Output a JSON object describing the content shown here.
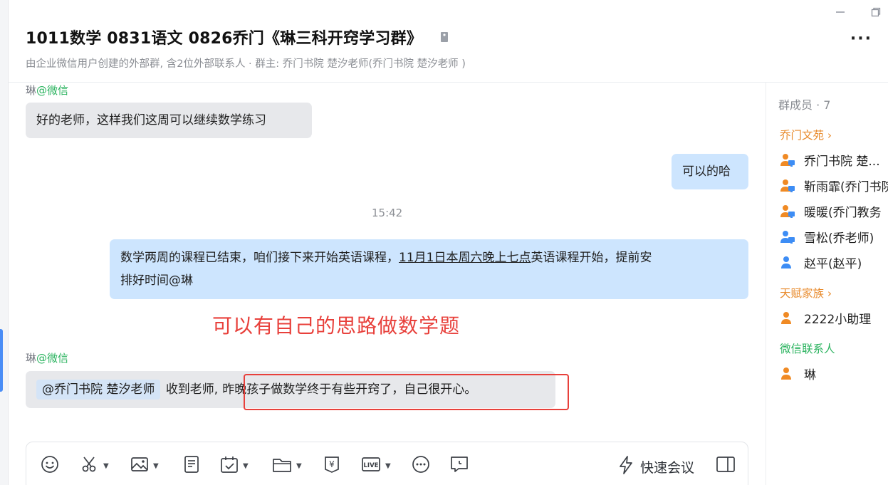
{
  "window": {
    "minimize_label": "minimize",
    "restore_label": "restore"
  },
  "header": {
    "title": "1011数学 0831语文 0826乔门《琳三科开窍学习群》",
    "subtitle": "由企业微信用户创建的外部群, 含2位外部联系人 · 群主: 乔门书院 楚汐老师(乔门书院 楚汐老师 )",
    "more_label": "···"
  },
  "messages": {
    "sender1_name": "琳",
    "sender1_tag": "@微信",
    "msg1": "好的老师，这样我们这周可以继续数学练习",
    "msg2": "可以的哈",
    "timestamp": "15:42",
    "msg3_part1": "数学两周的课程已结束，咱们接下来开始英语课程，",
    "msg3_underlined": "11月1日本周六晚上七点",
    "msg3_part2": "英语课程开始，提前安",
    "msg3_line2": "排好时间@琳",
    "red_note": "可以有自己的思路做数学题",
    "sender2_name": "琳",
    "sender2_tag": "@微信",
    "msg4_mention": "@乔门书院 楚汐老师",
    "msg4_part1": "收到老师,",
    "msg4_part2": "昨晚孩子做数学终于有些开窍了，自己很开心。"
  },
  "members": {
    "title": "群成员 · 7",
    "group1": "乔门文苑 ›",
    "group1_members": [
      "乔门书院 楚...",
      "靳雨霏(乔门书院",
      "暖暖(乔门教务",
      "雪松(乔老师)",
      "赵平(赵平)"
    ],
    "group2": "天赋家族 ›",
    "group2_members": [
      "2222小助理"
    ],
    "group3": "微信联系人",
    "group3_members": [
      "琳"
    ]
  },
  "toolbar": {
    "quick_meeting_label": "快速会议",
    "icons": [
      "emoji-icon",
      "scissors-icon",
      "image-icon",
      "document-icon",
      "calendar-check-icon",
      "folder-icon",
      "yuan-icon",
      "live-icon",
      "more-circle-icon",
      "chat-box-icon",
      "lightning-icon",
      "sidebar-toggle-icon"
    ],
    "live_text": "LIVE",
    "yuan_text": "¥"
  },
  "colors": {
    "accent_blue": "#4a8df6",
    "out_bubble": "#cde5fe",
    "in_bubble": "#e7e8eb",
    "red_annotation": "#e8403b",
    "group_orange": "#e88a2b",
    "wechat_green": "#2bb35f"
  }
}
